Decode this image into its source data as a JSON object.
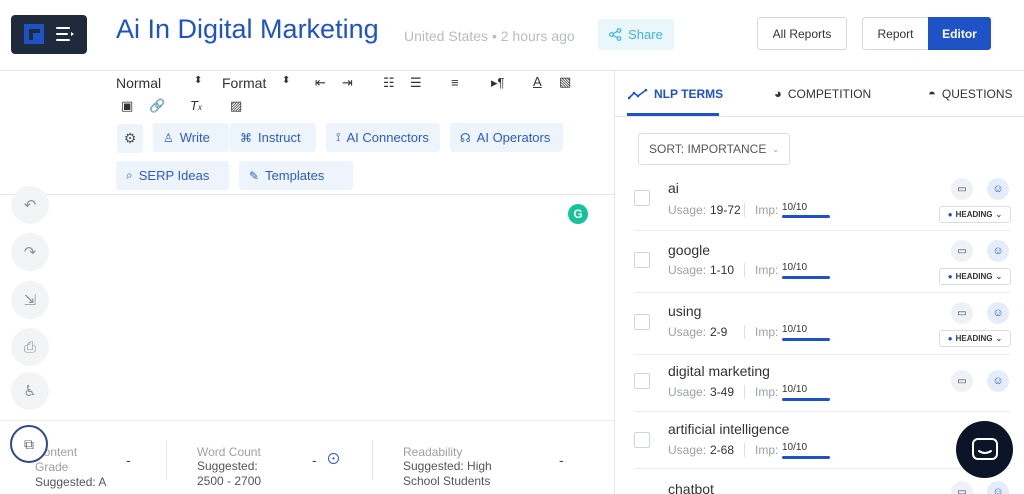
{
  "header": {
    "title": "Ai In Digital Marketing",
    "meta": "United States • 2 hours ago",
    "share_label": "Share",
    "all_reports_label": "All Reports",
    "report_label": "Report",
    "editor_label": "Editor"
  },
  "toolbar": {
    "style_select": "Normal",
    "format_select": "Format",
    "chips": [
      {
        "label": "Write",
        "icon": "wand-icon"
      },
      {
        "label": "Instruct",
        "icon": "command-icon"
      },
      {
        "label": "AI Connectors",
        "icon": "ai-connector-icon"
      },
      {
        "label": "AI Operators",
        "icon": "ai-operator-icon"
      },
      {
        "label": "SERP Ideas",
        "icon": "search-icon"
      },
      {
        "label": "Templates",
        "icon": "template-icon"
      }
    ]
  },
  "stats": {
    "content_grade_label": "Content Grade",
    "content_grade_sub": "Suggested: A",
    "content_grade_val": "-",
    "word_count_label": "Word Count",
    "word_count_sub": "Suggested: 2500 - 2700",
    "word_count_val": "-",
    "readability_label": "Readability",
    "readability_sub": "Suggested: High School Students",
    "readability_val": "-"
  },
  "panel": {
    "tabs": [
      "NLP TERMS",
      "COMPETITION",
      "QUESTIONS"
    ],
    "sort_label": "SORT: IMPORTANCE",
    "usage_label": "Usage:",
    "imp_label": "Imp:",
    "heading_label": "HEADING",
    "terms": [
      {
        "name": "ai",
        "usage": "19-72",
        "imp": "10/10",
        "heading": true
      },
      {
        "name": "google",
        "usage": "1-10",
        "imp": "10/10",
        "heading": true
      },
      {
        "name": "using",
        "usage": "2-9",
        "imp": "10/10",
        "heading": true
      },
      {
        "name": "digital marketing",
        "usage": "3-49",
        "imp": "10/10",
        "heading": false
      },
      {
        "name": "artificial intelligence",
        "usage": "2-68",
        "imp": "10/10",
        "heading": false
      },
      {
        "name": "chatbot",
        "usage": "",
        "imp": "",
        "heading": false
      }
    ]
  },
  "colors": {
    "accent": "#1f53c5",
    "logo_bg": "#1f2a3a",
    "share_text": "#3fb5d3",
    "chip_bg": "#eef4fb",
    "grammarly": "#15c39a",
    "chat_bg": "#0c1428"
  }
}
